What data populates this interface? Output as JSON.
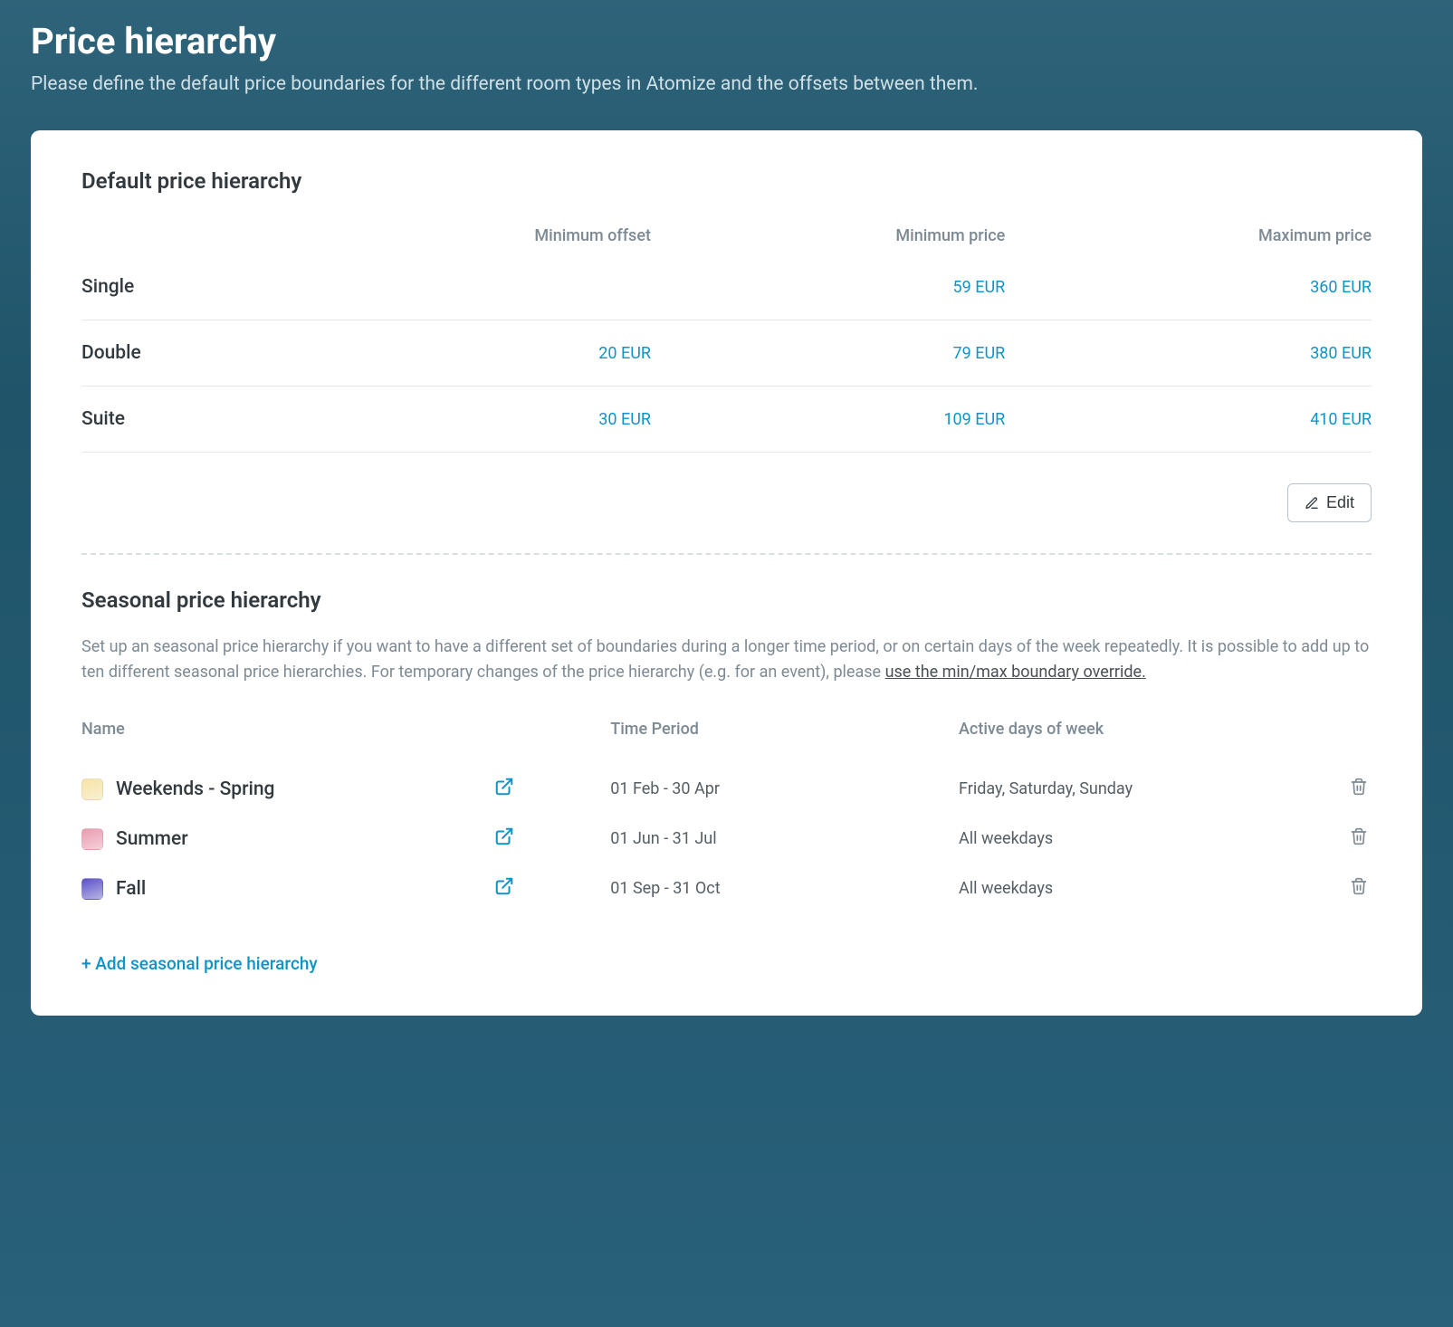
{
  "header": {
    "title": "Price hierarchy",
    "subtitle": "Please define the default price boundaries for the different room types in Atomize and the offsets between them."
  },
  "default_table": {
    "title": "Default price hierarchy",
    "columns": {
      "minimum_offset": "Minimum offset",
      "minimum_price": "Minimum price",
      "maximum_price": "Maximum price"
    },
    "rows": [
      {
        "name": "Single",
        "minimum_offset": "",
        "minimum_price": "59 EUR",
        "maximum_price": "360 EUR"
      },
      {
        "name": "Double",
        "minimum_offset": "20 EUR",
        "minimum_price": "79 EUR",
        "maximum_price": "380 EUR"
      },
      {
        "name": "Suite",
        "minimum_offset": "30 EUR",
        "minimum_price": "109 EUR",
        "maximum_price": "410 EUR"
      }
    ],
    "edit_label": "Edit"
  },
  "seasonal": {
    "title": "Seasonal price hierarchy",
    "description_prefix": "Set up an seasonal price hierarchy if you want to have a different set of boundaries during a longer time period, or on certain days of the week repeatedly. It is possible to add up to ten different seasonal price hierarchies. For temporary changes of the price hierarchy (e.g. for an event), please ",
    "description_link": "use the min/max boundary override.",
    "columns": {
      "name": "Name",
      "time_period": "Time Period",
      "active_days": "Active days of week"
    },
    "rows": [
      {
        "name": "Weekends - Spring",
        "time_period": "01 Feb - 30 Apr",
        "active_days": "Friday, Saturday, Sunday"
      },
      {
        "name": "Summer",
        "time_period": "01 Jun - 31 Jul",
        "active_days": "All weekdays"
      },
      {
        "name": "Fall",
        "time_period": "01 Sep - 31 Oct",
        "active_days": "All weekdays"
      }
    ],
    "add_label": "+ Add seasonal price hierarchy"
  }
}
